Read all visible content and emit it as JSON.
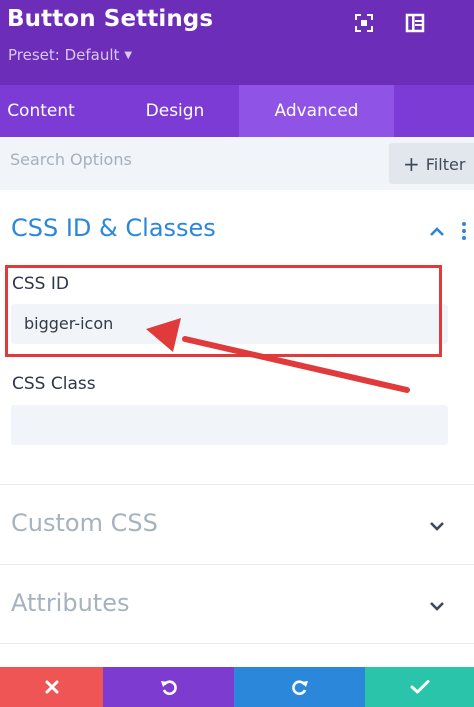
{
  "header": {
    "title": "Button Settings",
    "preset_label": "Preset: Default",
    "bg_color": "#6c2eb9",
    "icons": [
      "fullscreen-icon",
      "split-view-icon"
    ]
  },
  "tabs": [
    {
      "label": "Content",
      "active": false
    },
    {
      "label": "Design",
      "active": false
    },
    {
      "label": "Advanced",
      "active": true
    }
  ],
  "search": {
    "placeholder": "Search Options",
    "filter_label": "Filter"
  },
  "sections": {
    "css_id_classes": {
      "title": "CSS ID & Classes",
      "expanded": true,
      "fields": {
        "css_id": {
          "label": "CSS ID",
          "value": "bigger-icon"
        },
        "css_class": {
          "label": "CSS Class",
          "value": ""
        }
      }
    },
    "custom_css": {
      "title": "Custom CSS",
      "expanded": false
    },
    "attributes": {
      "title": "Attributes",
      "expanded": false
    }
  },
  "annotation": {
    "highlight_color": "#e03a3a",
    "target": "css_id"
  },
  "bottom_bar": {
    "buttons": [
      {
        "action": "cancel",
        "icon": "close-icon",
        "color": "#ef5555"
      },
      {
        "action": "undo",
        "icon": "undo-icon",
        "color": "#7e3bd0"
      },
      {
        "action": "redo",
        "icon": "redo-icon",
        "color": "#2b87da"
      },
      {
        "action": "save",
        "icon": "check-icon",
        "color": "#29c4a9"
      }
    ]
  }
}
